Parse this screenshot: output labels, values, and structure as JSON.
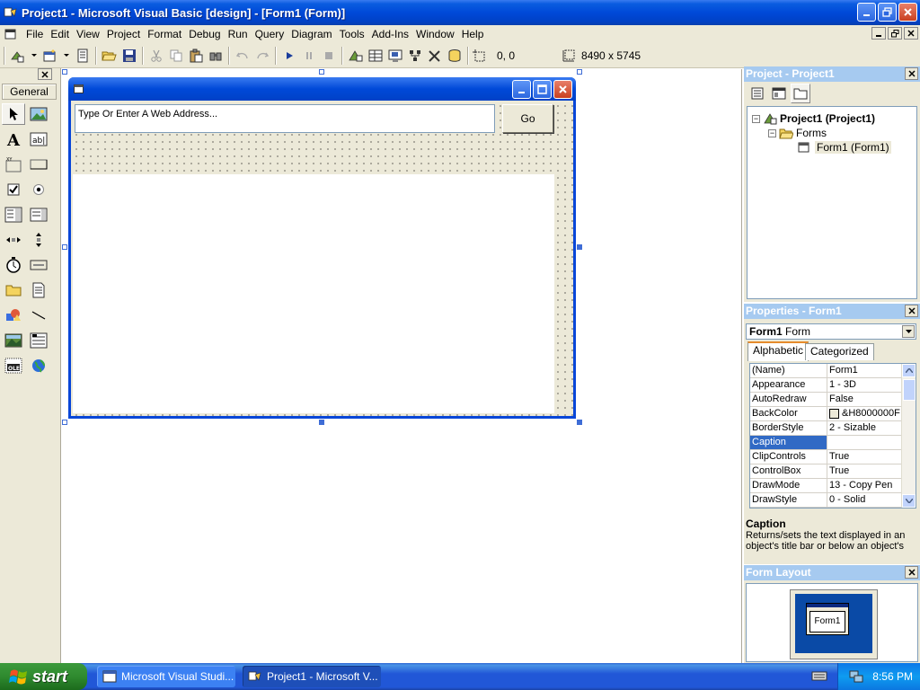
{
  "window": {
    "title": "Project1 - Microsoft Visual Basic [design] - [Form1 (Form)]"
  },
  "menubar": {
    "items": [
      "File",
      "Edit",
      "View",
      "Project",
      "Format",
      "Debug",
      "Run",
      "Query",
      "Diagram",
      "Tools",
      "Add-Ins",
      "Window",
      "Help"
    ]
  },
  "toolbar": {
    "position_readout": "0, 0",
    "size_readout": "8490 x 5745"
  },
  "toolbox": {
    "tab_label": "General",
    "tools": [
      "pointer-icon",
      "picturebox-icon",
      "label-icon",
      "textbox-icon",
      "frame-icon",
      "commandbutton-icon",
      "checkbox-icon",
      "optionbutton-icon",
      "combobox-icon",
      "listbox-icon",
      "hscrollbar-icon",
      "vscrollbar-icon",
      "timer-icon",
      "drivelistbox-icon",
      "dirlistbox-icon",
      "filelistbox-icon",
      "shape-icon",
      "line-icon",
      "image-icon",
      "data-icon",
      "ole-icon",
      "webbrowser-icon"
    ]
  },
  "form": {
    "address_placeholder": "Type Or Enter A Web Address...",
    "go_label": "Go"
  },
  "project_panel": {
    "title": "Project - Project1",
    "tree": {
      "root": "Project1 (Project1)",
      "folder": "Forms",
      "leaf": "Form1 (Form1)"
    }
  },
  "properties_panel": {
    "title": "Properties - Form1",
    "object_name": "Form1",
    "object_type": "Form",
    "tabs": [
      "Alphabetic",
      "Categorized"
    ],
    "active_tab": "Alphabetic",
    "rows": [
      {
        "name": "(Name)",
        "value": "Form1"
      },
      {
        "name": "Appearance",
        "value": "1 - 3D"
      },
      {
        "name": "AutoRedraw",
        "value": "False"
      },
      {
        "name": "BackColor",
        "value": "&H8000000F"
      },
      {
        "name": "BorderStyle",
        "value": "2 - Sizable"
      },
      {
        "name": "Caption",
        "value": ""
      },
      {
        "name": "ClipControls",
        "value": "True"
      },
      {
        "name": "ControlBox",
        "value": "True"
      },
      {
        "name": "DrawMode",
        "value": "13 - Copy Pen"
      },
      {
        "name": "DrawStyle",
        "value": "0 - Solid"
      }
    ],
    "selected_row": "Caption",
    "description_title": "Caption",
    "description_text": "Returns/sets the text displayed in an object's title bar or below an object's"
  },
  "form_layout_panel": {
    "title": "Form Layout",
    "mini_form_label": "Form1"
  },
  "taskbar": {
    "start_label": "start",
    "tasks": [
      "Microsoft Visual Studi...",
      "Project1 - Microsoft V..."
    ],
    "clock": "8:56 PM"
  },
  "colors": {
    "xp_blue": "#0049d8",
    "face": "#ece9d8",
    "selection": "#316ac5",
    "panel_title": "#a6caf0",
    "start_green": "#2f8a2f"
  }
}
